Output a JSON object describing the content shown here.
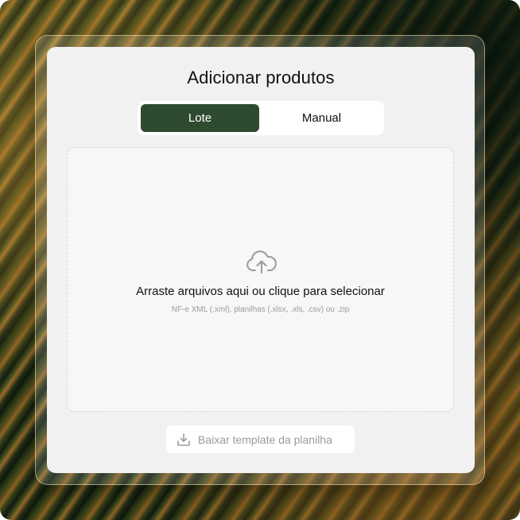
{
  "modal": {
    "title": "Adicionar produtos"
  },
  "tabs": [
    {
      "label": "Lote",
      "active": true
    },
    {
      "label": "Manual",
      "active": false
    }
  ],
  "dropzone": {
    "icon": "cloud-upload-icon",
    "main_text": "Arraste arquivos aqui ou clique para selecionar",
    "sub_text": "NF-e XML (.xml), planilhas (.xlsx, .xls, .csv) ou .zip"
  },
  "download_button": {
    "icon": "download-icon",
    "label": "Baixar template da planilha"
  },
  "colors": {
    "accent": "#2e4a2f",
    "card_bg": "#f1f1f2",
    "dropzone_bg": "#f7f7f7",
    "muted_text": "#9a9a9a"
  }
}
